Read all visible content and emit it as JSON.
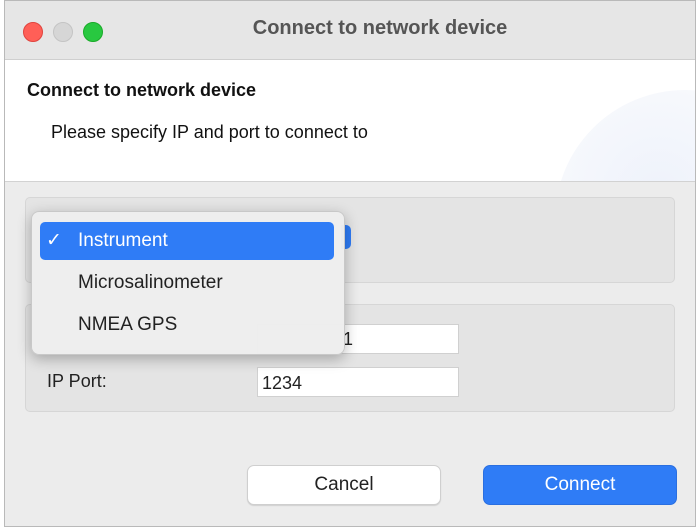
{
  "window": {
    "title": "Connect to network device"
  },
  "header": {
    "title": "Connect to network device",
    "description": "Please specify IP and port to connect to"
  },
  "device_type": {
    "options": [
      "Instrument",
      "Microsalinometer",
      "NMEA GPS"
    ],
    "selected": "Instrument",
    "check_glyph": "✓"
  },
  "connection": {
    "ip_address_visible": "1",
    "port_label": "IP Port:",
    "port_value": "1234"
  },
  "buttons": {
    "cancel": "Cancel",
    "connect": "Connect"
  },
  "colors": {
    "accent": "#2f7cf6",
    "close": "#ff5f57",
    "zoom": "#28c840"
  }
}
